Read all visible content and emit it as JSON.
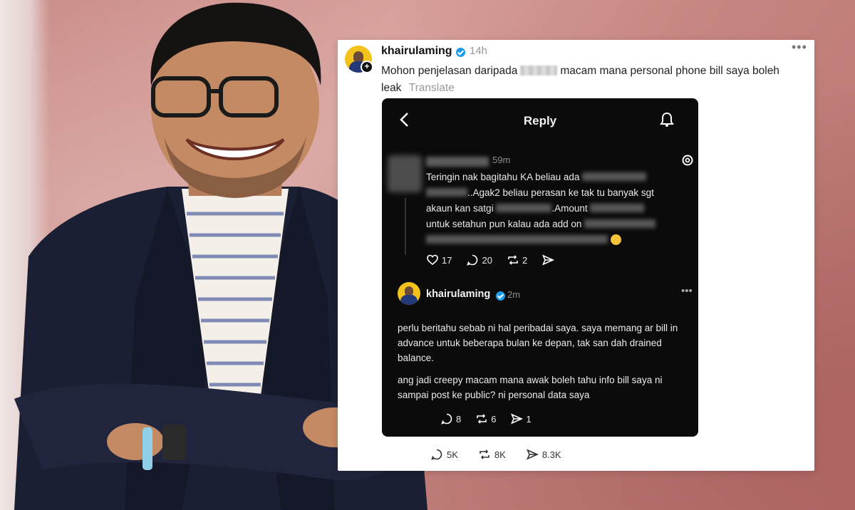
{
  "post": {
    "username": "khairulaming",
    "time": "14h",
    "text_before": "Mohon penjelasan daripada",
    "text_after": "macam mana personal phone bill saya boleh leak",
    "translate": "Translate",
    "replies": "5K",
    "reposts": "8K",
    "shares": "8.3K"
  },
  "screenshot": {
    "title": "Reply",
    "comment1": {
      "time": "59m",
      "line1": "Teringin nak bagitahu KA beliau ada",
      "line2": "..Agak2 beliau perasan ke tak tu banyak sgt",
      "line3": "akaun kan satgi",
      "line3b": ".Amount",
      "line4": "untuk setahun pun kalau ada add on",
      "likes": "17",
      "replies": "20",
      "reposts": "2"
    },
    "comment2": {
      "username": "khairulaming",
      "time": "2m",
      "para1": "perlu beritahu sebab ni hal peribadai saya. saya memang ar bill in advance untuk beberapa bulan ke depan, tak san dah drained balance.",
      "para2": "ang jadi creepy macam mana awak boleh tahu info bill saya ni sampai post ke public? ni personal data saya",
      "replies": "8",
      "reposts": "6",
      "shares": "1"
    }
  },
  "colors": {
    "verified": "#1d9bf0",
    "background": "#c98a86",
    "dark_panel": "#0b0b0b"
  }
}
